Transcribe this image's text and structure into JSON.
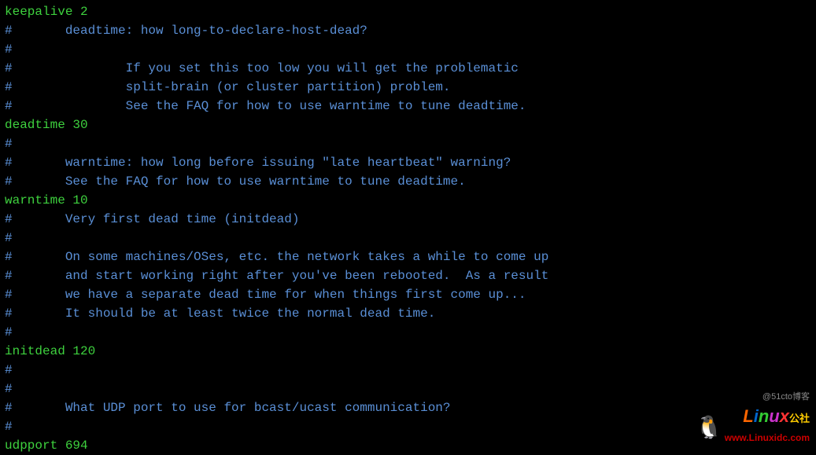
{
  "lines": [
    {
      "type": "setting",
      "text": "keepalive 2"
    },
    {
      "type": "comment",
      "text": "#       deadtime: how long-to-declare-host-dead?"
    },
    {
      "type": "comment",
      "text": "#"
    },
    {
      "type": "comment",
      "text": "#               If you set this too low you will get the problematic"
    },
    {
      "type": "comment",
      "text": "#               split-brain (or cluster partition) problem."
    },
    {
      "type": "comment",
      "text": "#               See the FAQ for how to use warntime to tune deadtime."
    },
    {
      "type": "setting",
      "text": "deadtime 30"
    },
    {
      "type": "comment",
      "text": "#"
    },
    {
      "type": "comment",
      "text": "#       warntime: how long before issuing \"late heartbeat\" warning?"
    },
    {
      "type": "comment",
      "text": "#       See the FAQ for how to use warntime to tune deadtime."
    },
    {
      "type": "setting",
      "text": "warntime 10"
    },
    {
      "type": "comment",
      "text": "#       Very first dead time (initdead)"
    },
    {
      "type": "comment",
      "text": "#"
    },
    {
      "type": "comment",
      "text": "#       On some machines/OSes, etc. the network takes a while to come up"
    },
    {
      "type": "comment",
      "text": "#       and start working right after you've been rebooted.  As a result"
    },
    {
      "type": "comment",
      "text": "#       we have a separate dead time for when things first come up..."
    },
    {
      "type": "comment",
      "text": "#       It should be at least twice the normal dead time."
    },
    {
      "type": "comment",
      "text": "#"
    },
    {
      "type": "setting",
      "text": "initdead 120"
    },
    {
      "type": "comment",
      "text": "#"
    },
    {
      "type": "comment",
      "text": "#"
    },
    {
      "type": "comment",
      "text": "#       What UDP port to use for bcast/ucast communication?"
    },
    {
      "type": "comment",
      "text": "#"
    },
    {
      "type": "setting",
      "text": "udpport 694"
    }
  ],
  "watermark": {
    "top": "@51cto博客",
    "logo_l": "L",
    "logo_i": "i",
    "logo_n": "n",
    "logo_u": "u",
    "logo_x": "x",
    "gongshe": "公社",
    "url": "www.Linuxidc.com"
  }
}
